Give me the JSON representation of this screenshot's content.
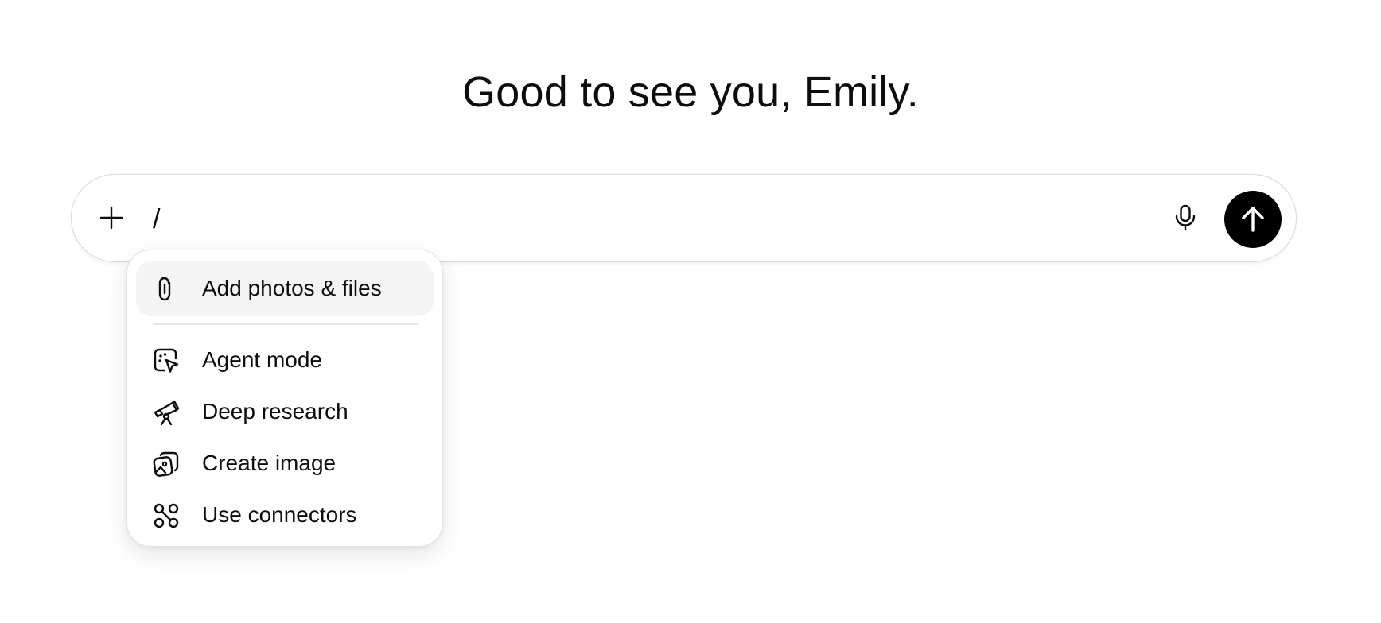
{
  "greeting": "Good to see you, Emily.",
  "composer": {
    "input_value": "/",
    "add_icon": "plus-icon",
    "mic_icon": "microphone-icon",
    "send_icon": "arrow-up-icon"
  },
  "menu": {
    "items": [
      {
        "label": "Add photos & files",
        "icon": "paperclip-icon"
      },
      {
        "label": "Agent mode",
        "icon": "agent-cursor-icon"
      },
      {
        "label": "Deep research",
        "icon": "telescope-icon"
      },
      {
        "label": "Create image",
        "icon": "image-icon"
      },
      {
        "label": "Use connectors",
        "icon": "connectors-icon"
      }
    ]
  },
  "colors": {
    "send_button": "#000000",
    "highlight": "#f4f4f4",
    "text": "#0d0d0d",
    "border": "#d9d9d9"
  }
}
